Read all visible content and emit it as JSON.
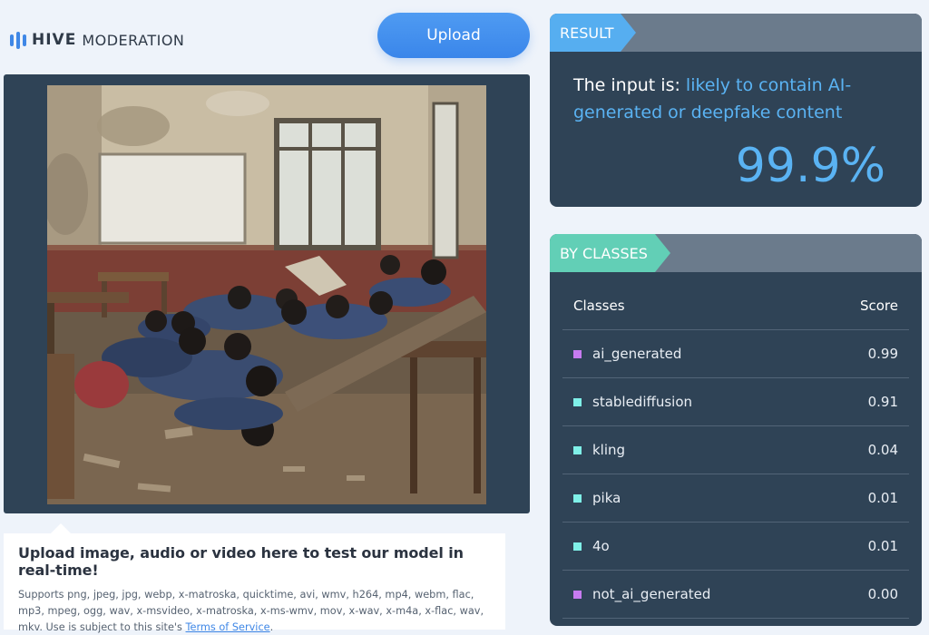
{
  "brand": {
    "name_bold": "HIVE",
    "name_regular": "MODERATION",
    "logo_color": "#3f87e6"
  },
  "header": {
    "upload_label": "Upload"
  },
  "upload_info": {
    "title": "Upload image, audio or video here to test our model in real-time!",
    "supports_text": "Supports png, jpeg, jpg, webp, x-matroska, quicktime, avi, wmv, h264, mp4, webm, flac, mp3, mpeg, ogg, wav, x-msvideo, x-matroska, x-ms-wmv, mov, x-wav, x-m4a, x-flac, wav, mkv. Use is subject to this site's",
    "tos_link": "Terms of Service",
    "suffix": "."
  },
  "result": {
    "tag": "RESULT",
    "prefix": "The input is:",
    "verdict": "likely to contain AI-generated or deepfake content",
    "score": "99.9%",
    "accent_color": "#56aef0"
  },
  "classes": {
    "tag": "BY CLASSES",
    "accent_color": "#62cfb6",
    "column_class": "Classes",
    "column_score": "Score",
    "rows": [
      {
        "name": "ai_generated",
        "score": "0.99",
        "color": "#c77bf0"
      },
      {
        "name": "stablediffusion",
        "score": "0.91",
        "color": "#7ff0e8"
      },
      {
        "name": "kling",
        "score": "0.04",
        "color": "#7ff0e8"
      },
      {
        "name": "pika",
        "score": "0.01",
        "color": "#7ff0e8"
      },
      {
        "name": "4o",
        "score": "0.01",
        "color": "#7ff0e8"
      },
      {
        "name": "not_ai_generated",
        "score": "0.00",
        "color": "#c77bf0"
      }
    ]
  }
}
